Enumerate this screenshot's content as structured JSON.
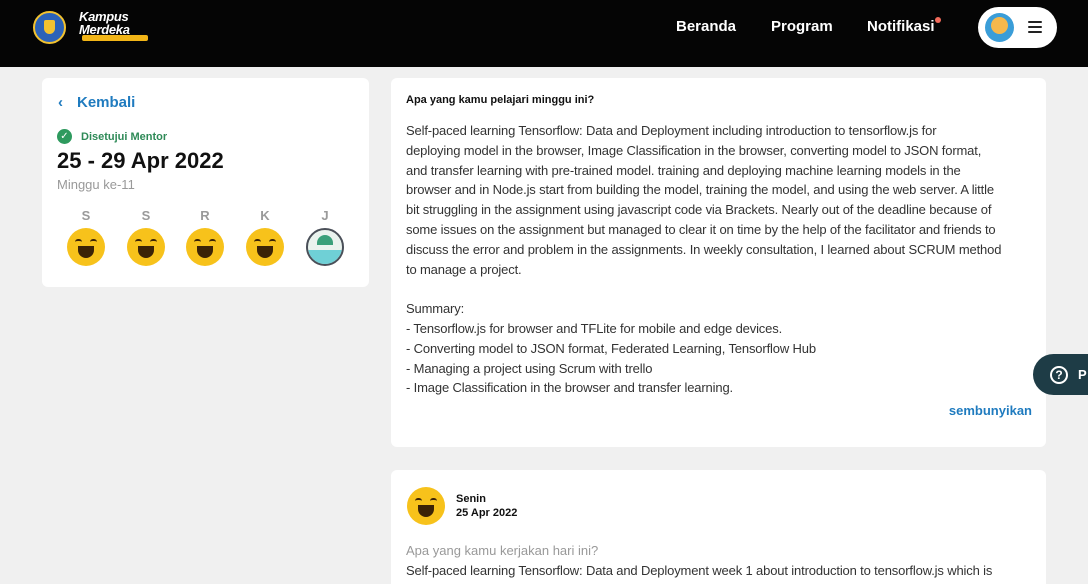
{
  "header": {
    "logo_line1": "Kampus",
    "logo_line2": "Merdeka",
    "nav": [
      "Beranda",
      "Program",
      "Notifikasi"
    ],
    "notification_dot_color": "#f26b5b"
  },
  "left_card": {
    "back_label": "Kembali",
    "status": "Disetujui Mentor",
    "week_range": "25 - 29 Apr 2022",
    "week_number": "Minggu ke-11",
    "days": [
      "S",
      "S",
      "R",
      "K",
      "J"
    ],
    "moods": [
      "happy-icon",
      "happy-icon",
      "happy-icon",
      "happy-icon",
      "holiday-icon"
    ]
  },
  "main_card": {
    "question": "Apa yang kamu pelajari minggu ini?",
    "lines": [
      "Self-paced learning Tensorflow: Data and Deployment including introduction to tensorflow.js  for",
      "deploying model in the browser, Image Classification in the browser, converting model to JSON format,",
      "and transfer learning with pre-trained model. training and deploying machine learning models in the",
      "browser and in Node.js start from building the model, training the model, and using the web server. A little",
      "bit struggling in the assignment using javascript code via Brackets. Nearly out of the deadline because of",
      "some issues on the assignment but managed to clear it on time by the help of the facilitator and friends to",
      "discuss the error and problem in the assignments. In weekly consultation, I learned about SCRUM method",
      "to manage a project.",
      "",
      "Summary:",
      "- Tensorflow.js for browser and TFLite for mobile and edge devices.",
      "- Converting model to JSON format, Federated Learning, Tensorflow Hub",
      "- Managing a project using Scrum  with trello",
      "- Image Classification in the browser and transfer learning."
    ],
    "hide_label": "sembunyikan"
  },
  "help_button": {
    "label": "P"
  },
  "day_card": {
    "day": "Senin",
    "date": "25 Apr 2022",
    "question": "Apa yang kamu kerjakan hari ini?",
    "answer": "Self-paced learning Tensorflow: Data and Deployment week 1 about introduction to tensorflow.js  which is"
  }
}
